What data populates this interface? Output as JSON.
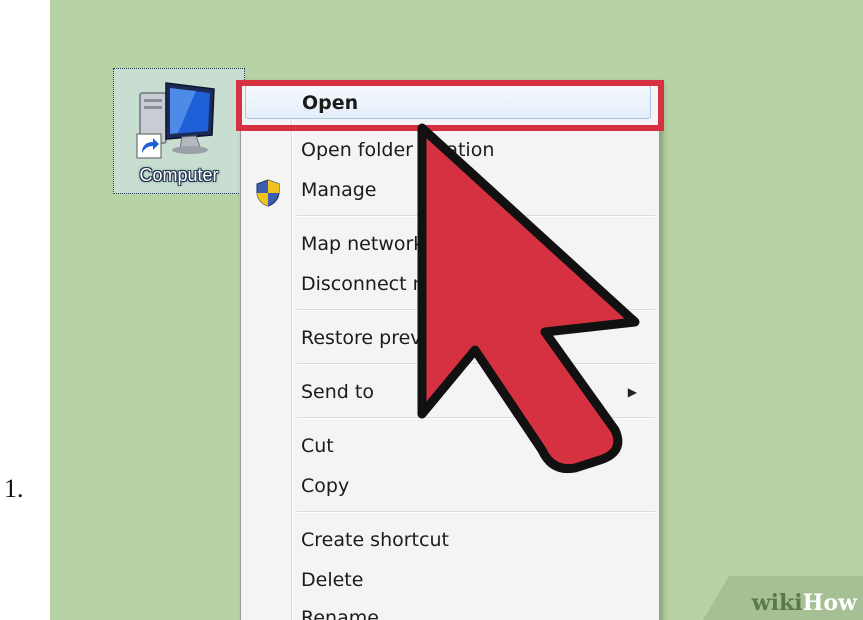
{
  "step": {
    "number": "1."
  },
  "desktop": {
    "background_color": "#b7d2a3",
    "icon": {
      "label": "Computer",
      "icon_name": "computer-icon",
      "shortcut_icon": "shortcut-arrow-icon"
    }
  },
  "context_menu": {
    "items": [
      {
        "label": "Open",
        "bold": true,
        "highlighted": true
      },
      {
        "label": "Open folder location"
      },
      {
        "label": "Manage",
        "icon": "uac-shield-icon"
      },
      {
        "label": "Map network drive..."
      },
      {
        "label": "Disconnect network drive..."
      },
      {
        "label": "Restore previous versions"
      },
      {
        "label": "Send to",
        "submenu": true
      },
      {
        "label": "Cut"
      },
      {
        "label": "Copy"
      },
      {
        "label": "Create shortcut"
      },
      {
        "label": "Delete"
      },
      {
        "label": "Rename"
      }
    ],
    "highlight_color": "#d63140"
  },
  "cursor": {
    "icon_name": "mouse-pointer-arrow-icon",
    "color": "#d63140"
  },
  "watermark": {
    "wiki": "wiki",
    "how": "How"
  }
}
